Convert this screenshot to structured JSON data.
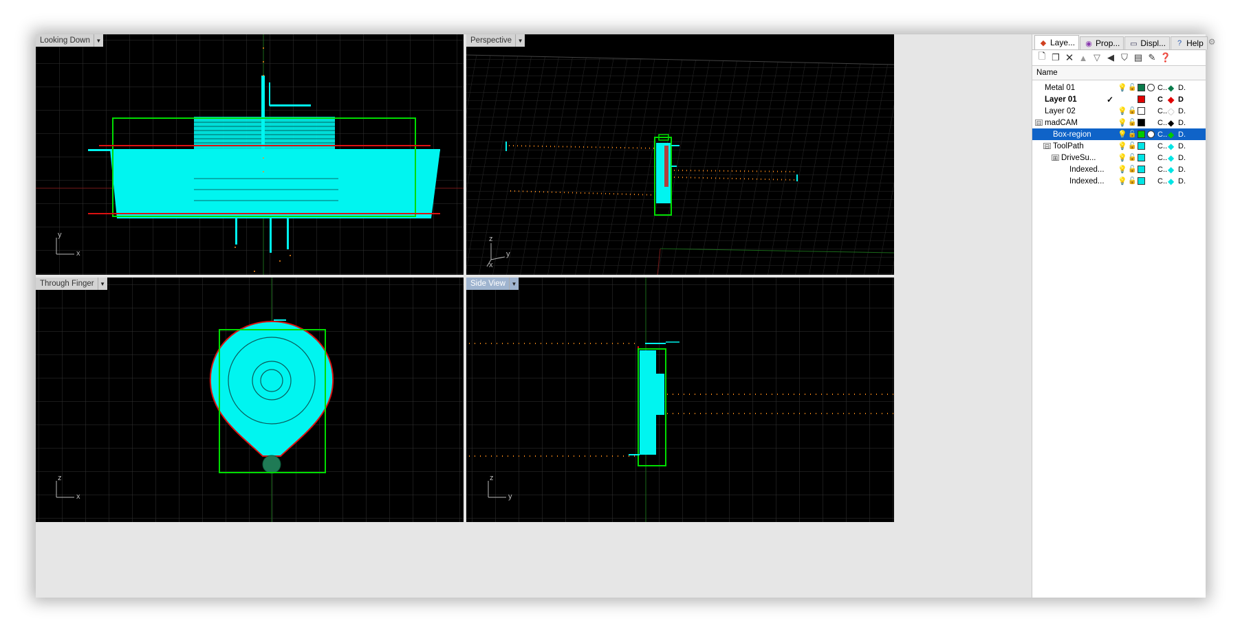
{
  "viewports": {
    "top": {
      "label": "Looking Down",
      "axis_a": "y",
      "axis_b": "x"
    },
    "persp": {
      "label": "Perspective",
      "axis_a": "z",
      "axis_b": "y",
      "axis_c": "x"
    },
    "front": {
      "label": "Through Finger",
      "axis_a": "z",
      "axis_b": "x"
    },
    "side": {
      "label": "Side View",
      "axis_a": "z",
      "axis_b": "y"
    }
  },
  "panel": {
    "tabs": [
      {
        "label": "Laye...",
        "icon": "layers-icon"
      },
      {
        "label": "Prop...",
        "icon": "properties-icon"
      },
      {
        "label": "Displ...",
        "icon": "display-icon"
      },
      {
        "label": "Help",
        "icon": "help-icon"
      }
    ],
    "column_header": "Name",
    "layers": [
      {
        "name": "Metal 01",
        "indent": 0,
        "color": "#0a7a4a",
        "mat": "circle",
        "lt": "C..",
        "pc": "#0a7a4a",
        "pw": "D.",
        "current": ""
      },
      {
        "name": "Layer 01",
        "indent": 0,
        "color": "#e00000",
        "mat": "",
        "lt": "C",
        "pc": "#e00000",
        "pw": "D",
        "current": "✓",
        "bold": true
      },
      {
        "name": "Layer 02",
        "indent": 0,
        "color": "#ffffff",
        "mat": "",
        "lt": "C..",
        "pc": "#ffffff",
        "pw": "D.",
        "current": ""
      },
      {
        "name": "madCAM",
        "indent": 0,
        "expander": "⊟",
        "color": "#000000",
        "mat": "",
        "lt": "C..",
        "pc": "#000000",
        "pw": "D.",
        "current": ""
      },
      {
        "name": "Box-region",
        "indent": 1,
        "color": "#00cc00",
        "mat": "circle",
        "lt": "C..",
        "pc": "#00cc00",
        "pw": "D.",
        "current": "",
        "selected": true
      },
      {
        "name": "ToolPath",
        "indent": 1,
        "expander": "⊟",
        "color": "#00e5e5",
        "mat": "",
        "lt": "C..",
        "pc": "#00e5e5",
        "pw": "D.",
        "current": ""
      },
      {
        "name": "DriveSu...",
        "indent": 2,
        "expander": "⊞",
        "color": "#00e5e5",
        "mat": "",
        "lt": "C..",
        "pc": "#00e5e5",
        "pw": "D.",
        "current": ""
      },
      {
        "name": "Indexed...",
        "indent": 3,
        "color": "#00e5e5",
        "mat": "",
        "lt": "C..",
        "pc": "#00e5e5",
        "pw": "D.",
        "current": ""
      },
      {
        "name": "Indexed...",
        "indent": 3,
        "color": "#00e5e5",
        "mat": "",
        "lt": "C..",
        "pc": "#00e5e5",
        "pw": "D.",
        "current": ""
      }
    ]
  },
  "colors": {
    "cyan": "#00f5f0",
    "green": "#00dd00",
    "red": "#dd1111",
    "orange": "#ff8c1a",
    "grid": "#3a3a3a",
    "selection": "#0f63c8"
  }
}
